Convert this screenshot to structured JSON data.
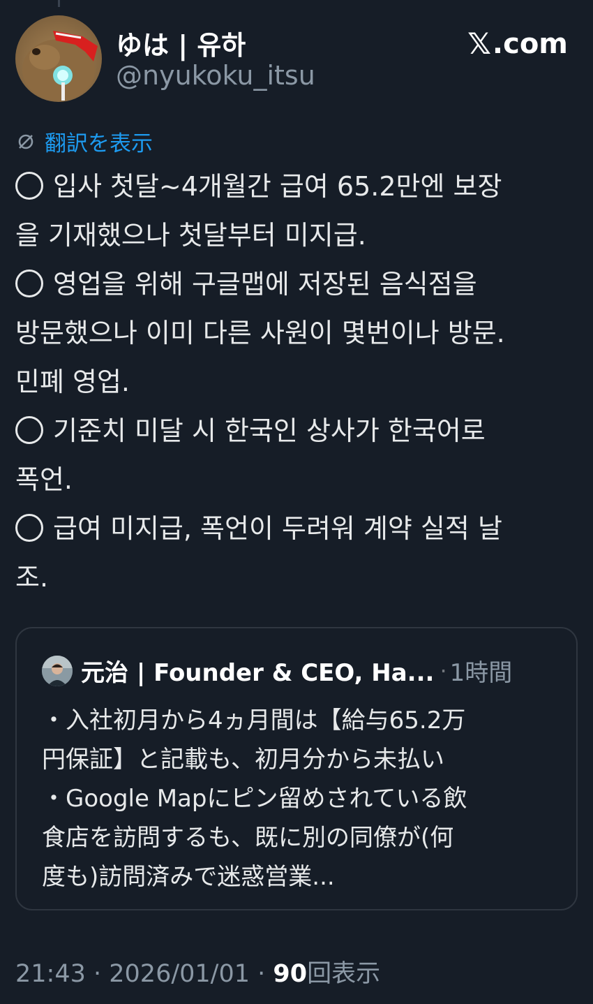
{
  "author": {
    "display_name": "ゆは | 유하",
    "handle": "@nyukoku_itsu"
  },
  "brand": {
    "logo": "𝕏",
    "domain": ".com"
  },
  "translate": {
    "icon": "translate-icon",
    "label": "翻訳を表示"
  },
  "body_lines": [
    {
      "marker": "◯",
      "text": "입사 첫달~4개월간 급여 65.2만엔 보장"
    },
    {
      "marker": "",
      "text": "을 기재했으나 첫달부터 미지급."
    },
    {
      "marker": "◯",
      "text": "영업을 위해 구글맵에 저장된 음식점을"
    },
    {
      "marker": "",
      "text": "방문했으나 이미 다른 사원이 몇번이나 방문."
    },
    {
      "marker": "",
      "text": "민폐 영업."
    },
    {
      "marker": "◯",
      "text": "기준치 미달 시 한국인 상사가 한국어로"
    },
    {
      "marker": "",
      "text": "폭언."
    },
    {
      "marker": "◯",
      "text": "급여 미지급, 폭언이 두려워 계약 실적 날"
    },
    {
      "marker": "",
      "text": "조."
    }
  ],
  "quote": {
    "name": "元治 | Founder & CEO, Ha...",
    "separator": "·",
    "time": "1時間",
    "lines": [
      "・入社初月から4ヵ月間は【給与65.2万",
      "円保証】と記載も、初月分から未払い",
      "・Google Mapにピン留めされている飲",
      "食店を訪問するも、既に別の同僚が(何",
      "度も)訪問済みで迷惑営業..."
    ]
  },
  "meta": {
    "time": "21:43",
    "sep1": " · ",
    "date": "2026/01/01",
    "sep2": " · ",
    "views_count": "90",
    "views_label": "回表示"
  }
}
